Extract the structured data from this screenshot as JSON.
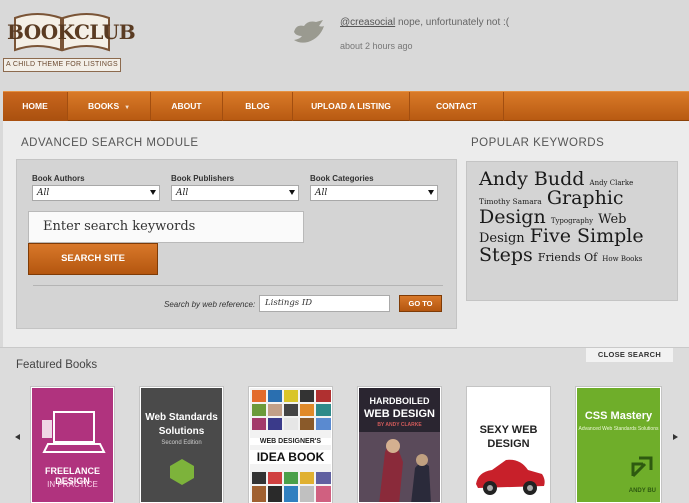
{
  "logo": {
    "wordmark": "BOOKCLUB",
    "tagline": "A CHILD THEME FOR LISTINGS"
  },
  "tweet": {
    "handle": "@creasocial",
    "text": " nope, unfortunately not :(",
    "time": "about 2 hours ago"
  },
  "nav": [
    {
      "label": "HOME"
    },
    {
      "label": "BOOKS"
    },
    {
      "label": "ABOUT"
    },
    {
      "label": "BLOG"
    },
    {
      "label": "UPLOAD A LISTING"
    },
    {
      "label": "CONTACT"
    }
  ],
  "search": {
    "title": "ADVANCED SEARCH MODULE",
    "authors_label": "Book Authors",
    "authors_value": "All",
    "publishers_label": "Book Publishers",
    "publishers_value": "All",
    "categories_label": "Book Categories",
    "categories_value": "All",
    "keywords_placeholder": "Enter search keywords",
    "button": "SEARCH SITE",
    "ref_label": "Search by web reference:",
    "ref_value": "Listings ID",
    "goto": "GO TO"
  },
  "keywords": {
    "title": "POPULAR KEYWORDS",
    "items": [
      "Andy Budd",
      "Andy Clarke",
      "Timothy Samara",
      "Graphic Design",
      "Typography",
      "Web Design",
      "Five Simple Steps",
      "Friends Of",
      "How Books"
    ]
  },
  "featured": {
    "title": "Featured Books",
    "close": "CLOSE SEARCH",
    "books": [
      {
        "title_top": "",
        "title": "FREELANCE DESIGN",
        "sub": "IN PRACTICE",
        "bg": "#b0337e"
      },
      {
        "title_top": "Web Standards",
        "title": "Solutions",
        "sub": "Second Edition",
        "bg": "#4a4a4a"
      },
      {
        "title_top": "WEB DESIGNER'S",
        "title": "IDEA BOOK",
        "sub": "",
        "bg": "#f2f2f2"
      },
      {
        "title_top": "HARDBOILED",
        "title": "WEB DESIGN",
        "sub": "BY ANDY CLARKE",
        "bg": "#2a2530"
      },
      {
        "title_top": "SEXY WEB",
        "title": "DESIGN",
        "sub": "",
        "bg": "#ffffff"
      },
      {
        "title_top": "CSS Mastery",
        "title": "Advanced Web Standards Solutions",
        "sub": "ANDY BU",
        "bg": "#6fae2a"
      }
    ]
  },
  "colors": {
    "accent": "#c9661d",
    "background": "#d9d9d9"
  }
}
